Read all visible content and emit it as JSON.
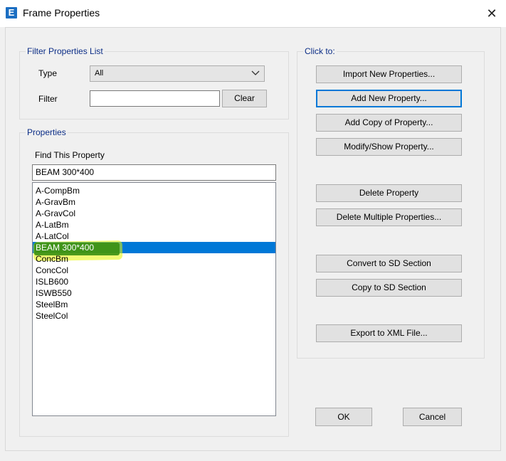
{
  "window": {
    "title": "Frame Properties",
    "app_icon_letter": "E",
    "close_glyph": "✕"
  },
  "filter": {
    "legend": "Filter Properties List",
    "type_label": "Type",
    "type_value": "All",
    "filter_label": "Filter",
    "filter_value": "",
    "clear_label": "Clear"
  },
  "properties": {
    "legend": "Properties",
    "find_label": "Find This Property",
    "find_value": "BEAM 300*400",
    "items": [
      "A-CompBm",
      "A-GravBm",
      "A-GravCol",
      "A-LatBm",
      "A-LatCol",
      "BEAM 300*400",
      "ConcBm",
      "ConcCol",
      "ISLB600",
      "ISWB550",
      "SteelBm",
      "SteelCol"
    ],
    "selected": "BEAM 300*400"
  },
  "clickto": {
    "legend": "Click to:",
    "buttons": [
      "Import New Properties...",
      "Add New Property...",
      "Add Copy of Property...",
      "Modify/Show Property...",
      "Delete Property",
      "Delete Multiple Properties...",
      "Convert to SD Section",
      "Copy to SD Section",
      "Export to XML File..."
    ]
  },
  "footer": {
    "ok_label": "OK",
    "cancel_label": "Cancel"
  },
  "colors": {
    "selection": "#0078d7",
    "legend_text": "#0b2d86",
    "highlight": "#e6f500",
    "focus_border": "#0078d7"
  }
}
